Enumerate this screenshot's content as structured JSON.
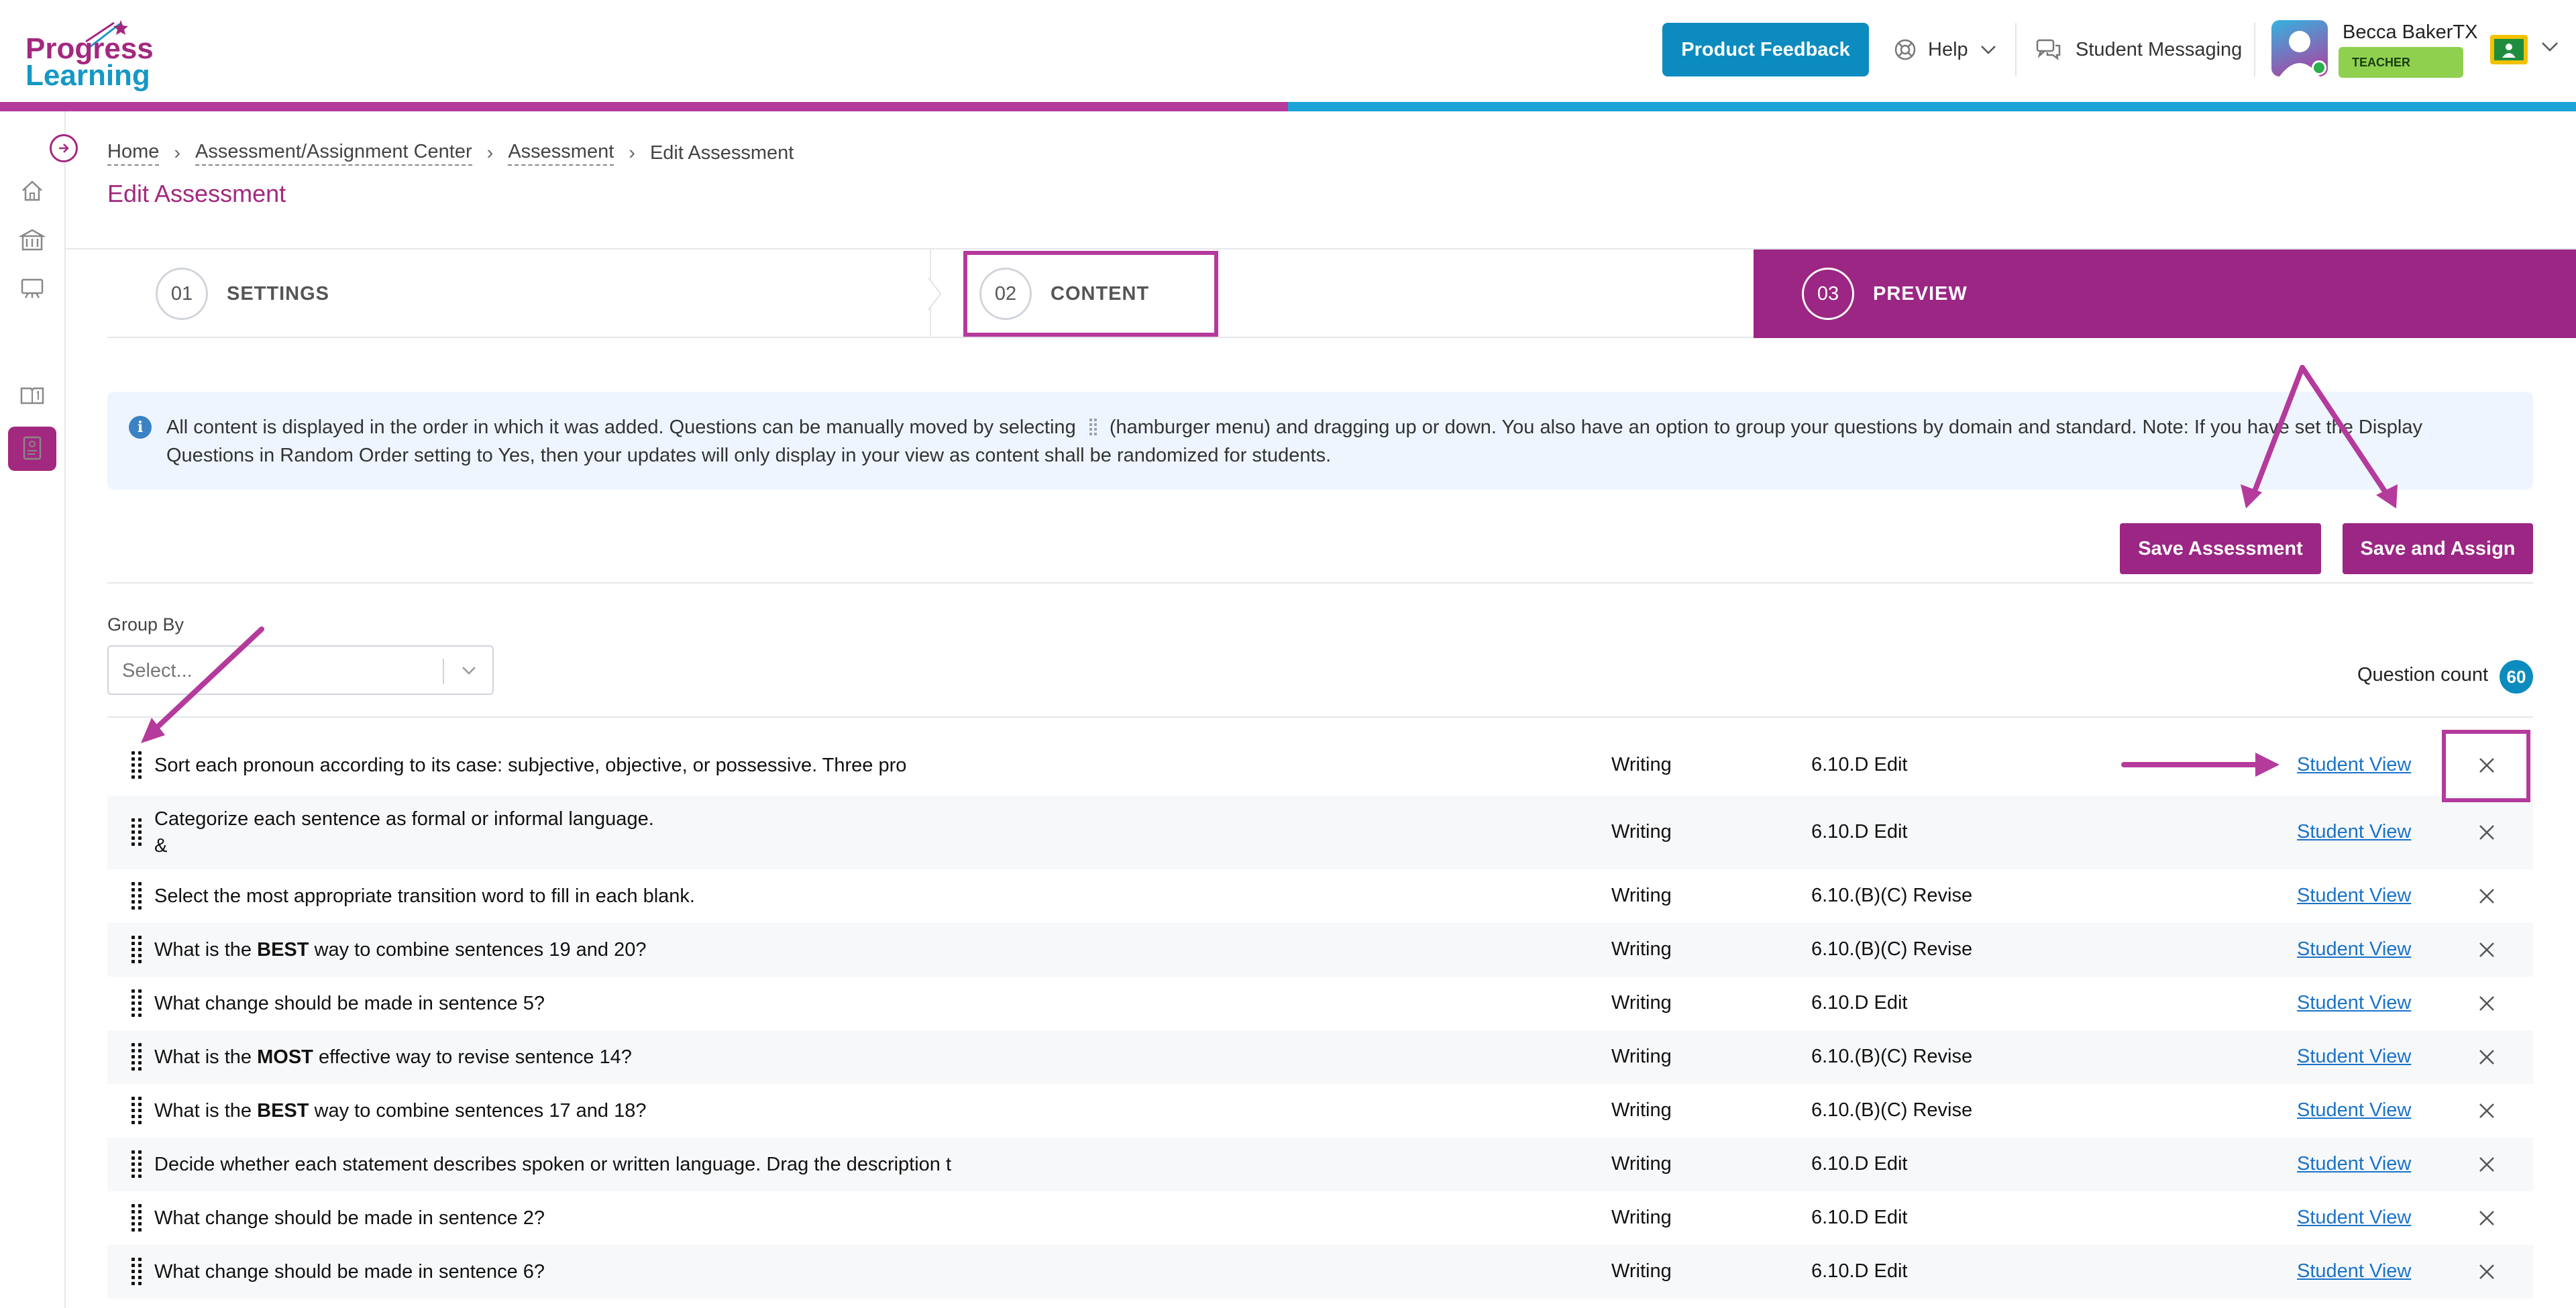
{
  "header": {
    "logo_line1": "Progress",
    "logo_line2": "Learning",
    "feedback_label": "Product Feedback",
    "help_label": "Help",
    "messaging_label": "Student Messaging",
    "user_name": "Becca BakerTX",
    "user_role": "TEACHER"
  },
  "breadcrumb": {
    "items": [
      "Home",
      "Assessment/Assignment Center",
      "Assessment"
    ],
    "current": "Edit Assessment"
  },
  "page_title": "Edit Assessment",
  "steps": [
    {
      "number": "01",
      "label": "SETTINGS"
    },
    {
      "number": "02",
      "label": "CONTENT"
    },
    {
      "number": "03",
      "label": "PREVIEW"
    }
  ],
  "info": {
    "text_part1": "All content is displayed in the order in which it was added. Questions can be manually moved by selecting",
    "text_part2": "(hamburger menu) and dragging up or down. You also have an option to group your questions by domain and standard. Note: If you have set the Display Questions in Random Order setting to Yes, then your updates will only display in your view as content shall be randomized for students."
  },
  "actions": {
    "save_assessment": "Save Assessment",
    "save_and_assign": "Save and Assign"
  },
  "group_by": {
    "label": "Group By",
    "placeholder": "Select..."
  },
  "question_count": {
    "label": "Question count",
    "value": "60"
  },
  "questions": [
    {
      "pre": "Sort each pronoun according to its case: subjective, objective, or possessive. Three pro",
      "bold": "",
      "post": "",
      "line2": "",
      "domain": "Writing",
      "standard": "6.10.D Edit",
      "link": "Student View"
    },
    {
      "pre": "Categorize each sentence as formal or informal language.",
      "bold": "",
      "post": "",
      "line2": "&",
      "domain": "Writing",
      "standard": "6.10.D Edit",
      "link": "Student View"
    },
    {
      "pre": "Select the most appropriate transition word to fill in each blank.",
      "bold": "",
      "post": "",
      "line2": "",
      "domain": "Writing",
      "standard": "6.10.(B)(C) Revise",
      "link": "Student View"
    },
    {
      "pre": "What is the ",
      "bold": "BEST",
      "post": " way to combine sentences 19 and 20?",
      "line2": "",
      "domain": "Writing",
      "standard": "6.10.(B)(C) Revise",
      "link": "Student View"
    },
    {
      "pre": "What change should be made in sentence 5?",
      "bold": "",
      "post": "",
      "line2": "",
      "domain": "Writing",
      "standard": "6.10.D Edit",
      "link": "Student View"
    },
    {
      "pre": "What is the ",
      "bold": "MOST",
      "post": " effective way to revise sentence 14?",
      "line2": "",
      "domain": "Writing",
      "standard": "6.10.(B)(C) Revise",
      "link": "Student View"
    },
    {
      "pre": "What is the ",
      "bold": "BEST",
      "post": " way to combine sentences 17 and 18?",
      "line2": "",
      "domain": "Writing",
      "standard": "6.10.(B)(C) Revise",
      "link": "Student View"
    },
    {
      "pre": "Decide whether each statement describes spoken or written language. Drag the description t",
      "bold": "",
      "post": "",
      "line2": "",
      "domain": "Writing",
      "standard": "6.10.D Edit",
      "link": "Student View"
    },
    {
      "pre": "What change should be made in sentence 2?",
      "bold": "",
      "post": "",
      "line2": "",
      "domain": "Writing",
      "standard": "6.10.D Edit",
      "link": "Student View"
    },
    {
      "pre": "What change should be made in sentence 6?",
      "bold": "",
      "post": "",
      "line2": "",
      "domain": "Writing",
      "standard": "6.10.D Edit",
      "link": "Student View"
    }
  ],
  "colors": {
    "brand_magenta": "#9b2684",
    "brand_blue": "#0c8bbf",
    "annotation": "#b43a9c",
    "link": "#1a73c9"
  }
}
